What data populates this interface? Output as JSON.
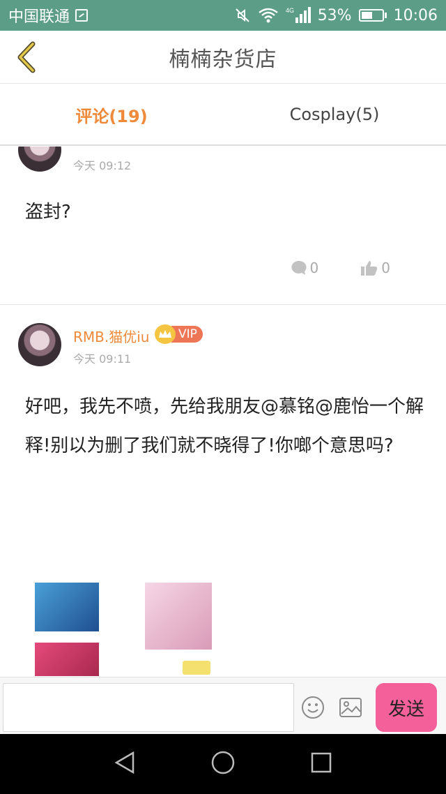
{
  "status_bar": {
    "carrier": "中国联通",
    "network": "4G",
    "battery": "53%",
    "battery_level": 0.53,
    "time": "10:06"
  },
  "header": {
    "title": "楠楠杂货店"
  },
  "tabs": [
    {
      "label": "评论(19)",
      "active": true
    },
    {
      "label": "Cosplay(5)",
      "active": false
    }
  ],
  "comments": [
    {
      "time": "今天 09:12",
      "text": "盗封?",
      "reply_count": "0",
      "like_count": "0"
    },
    {
      "username": "RMB.猫优iu",
      "badge": "VIP",
      "time": "今天 09:11",
      "text": "好吧，我先不喷，先给我朋友@慕铭@鹿怡一个解释!别以为删了我们就不晓得了!你啷个意思吗?"
    }
  ],
  "input_bar": {
    "send_label": "发送"
  },
  "colors": {
    "status_bar": "#5b9d87",
    "accent": "#ef8a3b",
    "send_button": "#f3609a",
    "vip": "#ef7557"
  }
}
